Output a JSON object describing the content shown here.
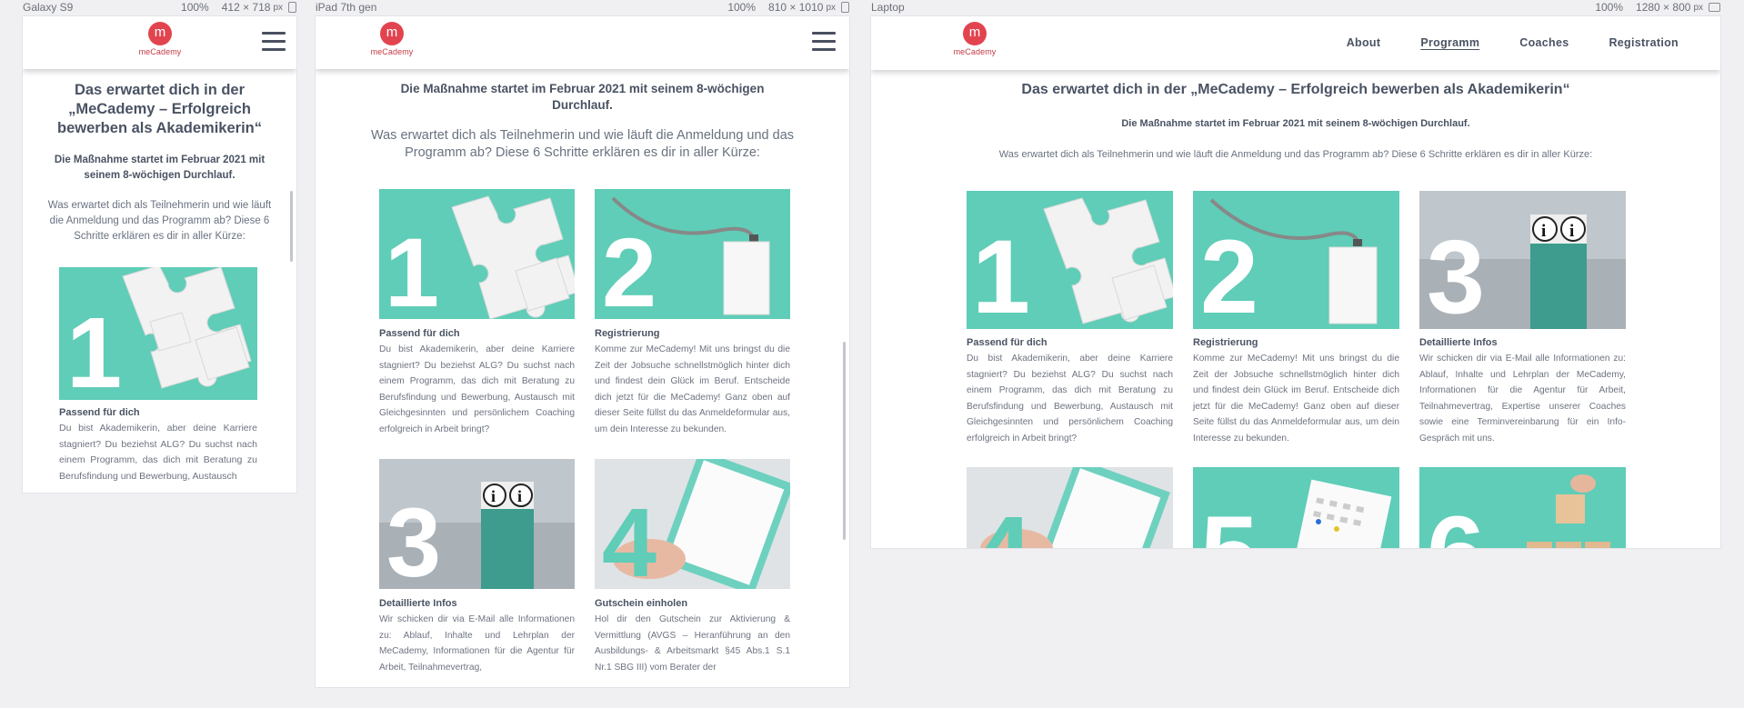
{
  "devices": [
    {
      "name": "Galaxy S9",
      "zoom": "100%",
      "size": "412 × 718",
      "unit": "px"
    },
    {
      "name": "iPad 7th gen",
      "zoom": "100%",
      "size": "810 × 1010",
      "unit": "px"
    },
    {
      "name": "Laptop",
      "zoom": "100%",
      "size": "1280 × 800",
      "unit": "px"
    }
  ],
  "brand": {
    "logo_letter": "m",
    "logo_text": "meCademy",
    "accent": "#e2444f",
    "teal": "#5fcdb7"
  },
  "nav": {
    "items": [
      "About",
      "Programm",
      "Coaches",
      "Registration"
    ],
    "active": "Programm"
  },
  "page": {
    "heading": "Das erwartet dich in der „MeCademy – Erfolgreich bewerben als Akademikerin“",
    "subheading": "Die Maßnahme startet im Februar 2021 mit seinem 8-wöchigen Durchlauf.",
    "intro": "Was erwartet dich als Teilnehmerin und wie läuft die Anmeldung und das Programm ab? Diese 6 Schritte erklären es dir in aller Kürze:"
  },
  "steps": [
    {
      "num": "1",
      "title": "Passend für dich",
      "text": "Du bist Akademikerin, aber deine Karriere stagniert? Du beziehst ALG? Du suchst nach einem Programm, das dich mit Beratung zu Berufsfindung und Bewerbung, Austausch mit Gleichgesinnten und persönlichem Coaching erfolgreich in Arbeit bringt?",
      "image": "puzzle-image"
    },
    {
      "num": "2",
      "title": "Registrierung",
      "text": "Komme zur MeCademy! Mit uns bringst du die Zeit der Jobsuche schnellstmöglich hinter dich und findest dein Glück im Beruf. Entscheide dich jetzt für die MeCademy! Ganz oben auf dieser Seite füllst du das Anmeldeformular aus, um dein Interesse zu bekunden.",
      "image": "badge-image"
    },
    {
      "num": "3",
      "title": "Detaillierte Infos",
      "text": "Wir schicken dir via E-Mail alle Informationen zu: Ablauf, Inhalte und Lehrplan der MeCademy, Informationen für die Agentur für Arbeit, Teilnahmevertrag, Expertise unserer Coaches sowie eine Terminvereinbarung für ein Info-Gespräch mit uns.",
      "text_ipad": "Wir schicken dir via E-Mail alle Informationen zu: Ablauf, Inhalte und Lehrplan der MeCademy, Informationen für die Agentur für Arbeit, Teilnahmevertrag,",
      "image": "info-image"
    },
    {
      "num": "4",
      "title": "Gutschein einholen",
      "text": "Hol dir den Gutschein zur Aktivierung & Vermittlung (AVGS – Heranführung an den Ausbildungs- & Arbeitsmarkt §45 Abs.1 S.1 Nr.1 SBG III) vom Berater der",
      "image": "clipboard-image"
    },
    {
      "num": "5",
      "title": "",
      "text": "",
      "image": "calendar-image"
    },
    {
      "num": "6",
      "title": "",
      "text": "",
      "image": "blocks-image"
    }
  ],
  "mobile_step1_text": "Du bist Akademikerin, aber deine Karriere stagniert? Du beziehst ALG? Du suchst nach einem Programm, das dich mit Beratung zu Berufsfindung und Bewerbung, Austausch"
}
